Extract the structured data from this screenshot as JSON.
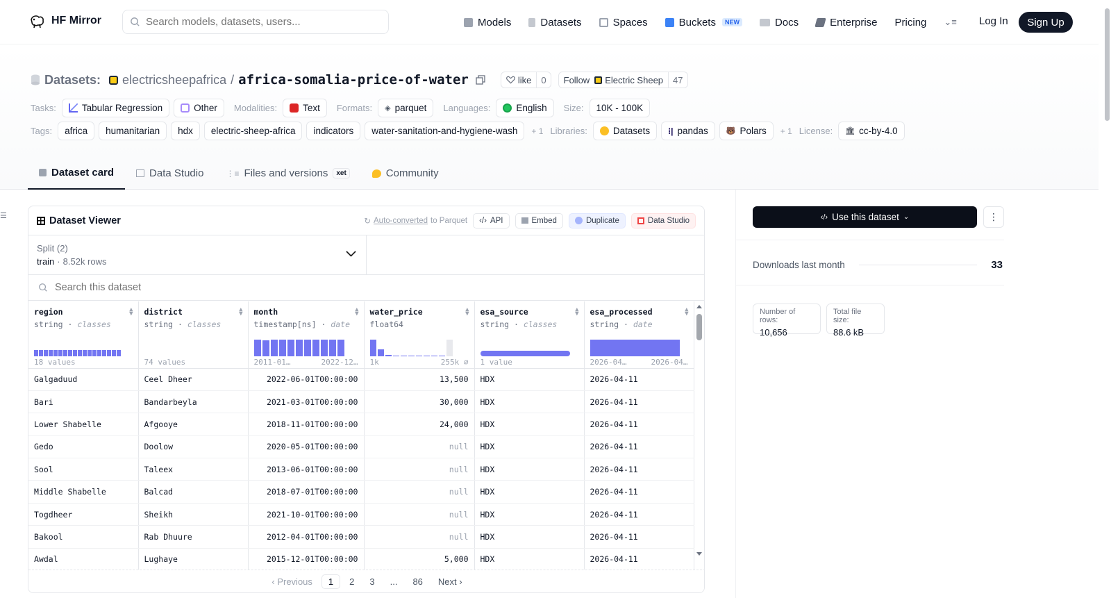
{
  "nav": {
    "brand": "HF Mirror",
    "search_placeholder": "Search models, datasets, users...",
    "links": [
      {
        "label": "Models",
        "icon": "cube-icon",
        "color": "#9ca3af"
      },
      {
        "label": "Datasets",
        "icon": "database-icon",
        "color": "#9ca3af"
      },
      {
        "label": "Spaces",
        "icon": "grid-icon",
        "color": "#9ca3af"
      },
      {
        "label": "Buckets",
        "icon": "bucket-icon",
        "color": "#3b82f6",
        "badge": "NEW"
      },
      {
        "label": "Docs",
        "icon": "book-icon",
        "color": "#9ca3af"
      },
      {
        "label": "Enterprise",
        "icon": "enterprise-icon",
        "color": "#6b7280"
      },
      {
        "label": "Pricing"
      }
    ],
    "login": "Log In",
    "signup": "Sign Up"
  },
  "repo": {
    "type_label": "Datasets:",
    "owner": "electricsheepafrica",
    "separator": "/",
    "name": "africa-somalia-price-of-water",
    "like_label": "like",
    "like_count": "0",
    "follow_label": "Follow",
    "follow_org": "Electric Sheep",
    "follow_count": "47"
  },
  "meta": {
    "tasks_label": "Tasks:",
    "tasks": [
      "Tabular Regression",
      "Other"
    ],
    "modalities_label": "Modalities:",
    "modalities": [
      "Text"
    ],
    "formats_label": "Formats:",
    "formats": [
      "parquet"
    ],
    "languages_label": "Languages:",
    "languages": [
      "English"
    ],
    "size_label": "Size:",
    "size": "10K - 100K",
    "tags_label": "Tags:",
    "tags": [
      "africa",
      "humanitarian",
      "hdx",
      "electric-sheep-africa",
      "indicators",
      "water-sanitation-and-hygiene-wash"
    ],
    "tags_more": "+ 1",
    "libraries_label": "Libraries:",
    "libraries": [
      "Datasets",
      "pandas",
      "Polars"
    ],
    "libraries_more": "+ 1",
    "license_label": "License:",
    "license": "cc-by-4.0"
  },
  "tabs": [
    {
      "label": "Dataset card",
      "active": true
    },
    {
      "label": "Data Studio"
    },
    {
      "label": "Files and versions",
      "badge": "xet"
    },
    {
      "label": "Community"
    }
  ],
  "viewer": {
    "title": "Dataset Viewer",
    "auto_converted": "Auto-converted",
    "to_parquet": "to Parquet",
    "actions": [
      "API",
      "Embed",
      "Duplicate",
      "Data Studio"
    ],
    "split_label": "Split (2)",
    "split_name": "train",
    "split_rows": "8.52k rows",
    "search_placeholder": "Search this dataset",
    "columns": [
      {
        "name": "region",
        "dtype": "string",
        "kind": "classes",
        "summary_left": "18 values",
        "summary_right": ""
      },
      {
        "name": "district",
        "dtype": "string",
        "kind": "classes",
        "summary_left": "74 values",
        "summary_right": ""
      },
      {
        "name": "month",
        "dtype": "timestamp[ns]",
        "kind": "date",
        "summary_left": "2011-01…",
        "summary_right": "2022-12…"
      },
      {
        "name": "water_price",
        "dtype": "float64",
        "kind": "",
        "summary_left": "1k",
        "summary_right": "255k ⌀"
      },
      {
        "name": "esa_source",
        "dtype": "string",
        "kind": "classes",
        "summary_left": "1 value",
        "summary_right": ""
      },
      {
        "name": "esa_processed",
        "dtype": "string",
        "kind": "date",
        "summary_left": "2026-04…",
        "summary_right": "2026-04…"
      }
    ],
    "rows": [
      [
        "Galgaduud",
        "Ceel Dheer",
        "2022-06-01T00:00:00",
        "13,500",
        "HDX",
        "2026-04-11"
      ],
      [
        "Bari",
        "Bandarbeyla",
        "2021-03-01T00:00:00",
        "30,000",
        "HDX",
        "2026-04-11"
      ],
      [
        "Lower Shabelle",
        "Afgooye",
        "2018-11-01T00:00:00",
        "24,000",
        "HDX",
        "2026-04-11"
      ],
      [
        "Gedo",
        "Doolow",
        "2020-05-01T00:00:00",
        "null",
        "HDX",
        "2026-04-11"
      ],
      [
        "Sool",
        "Taleex",
        "2013-06-01T00:00:00",
        "null",
        "HDX",
        "2026-04-11"
      ],
      [
        "Middle Shabelle",
        "Balcad",
        "2018-07-01T00:00:00",
        "null",
        "HDX",
        "2026-04-11"
      ],
      [
        "Togdheer",
        "Sheikh",
        "2021-10-01T00:00:00",
        "null",
        "HDX",
        "2026-04-11"
      ],
      [
        "Bakool",
        "Rab Dhuure",
        "2012-04-01T00:00:00",
        "null",
        "HDX",
        "2026-04-11"
      ],
      [
        "Awdal",
        "Lughaye",
        "2015-12-01T00:00:00",
        "5,000",
        "HDX",
        "2026-04-11"
      ]
    ],
    "pager": {
      "prev": "Previous",
      "pages": [
        "1",
        "2",
        "3",
        "...",
        "86"
      ],
      "current": "1",
      "next": "Next"
    }
  },
  "sidebar": {
    "use_button": "Use this dataset",
    "downloads_label": "Downloads last month",
    "downloads_value": "33",
    "rows_label": "Number of rows:",
    "rows_value": "10,656",
    "size_label": "Total file size:",
    "size_value": "88.6 kB"
  },
  "colors": {
    "accent": "#6366f1",
    "primary_dark": "#0b0f19"
  }
}
